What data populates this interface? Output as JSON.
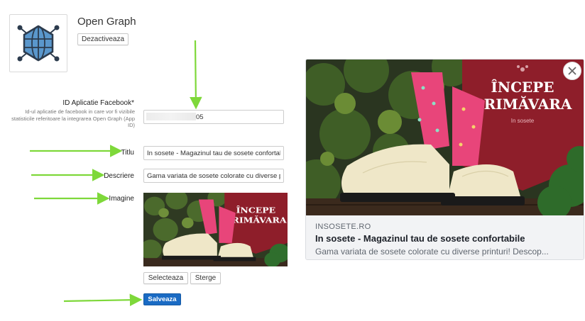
{
  "app": {
    "title": "Open Graph",
    "deactivate_label": "Dezactiveaza",
    "logo_icon": "globe-network-icon"
  },
  "form": {
    "app_id": {
      "label": "ID Aplicatie Facebook*",
      "help": "Id-ul aplicatie de facebook in care vor fi vizibile statisticile referitoare la integrarea Open Graph (App ID)",
      "value_visible_suffix": "05"
    },
    "title": {
      "label": "Titlu",
      "value": "In sosete - Magazinul tau de sosete confortabile"
    },
    "description": {
      "label": "Descriere",
      "value": "Gama variata de sosete colorate cu diverse printuri! Descoperiti"
    },
    "image": {
      "label": "Imagine",
      "select_label": "Selecteaza",
      "delete_label": "Sterge"
    },
    "save_label": "Salveaza"
  },
  "banner": {
    "line1": "ÎNCEPE",
    "line2": "PRIMĂVARA",
    "sub": "In sosete"
  },
  "preview": {
    "domain": "INSOSETE.RO",
    "title": "In sosete - Magazinul tau de sosete confortabile",
    "description": "Gama variata de sosete colorate cu diverse printuri! Descop..."
  },
  "colors": {
    "arrow": "#7ed83a",
    "save": "#1a6bc4",
    "banner": "#8e1e2a"
  }
}
